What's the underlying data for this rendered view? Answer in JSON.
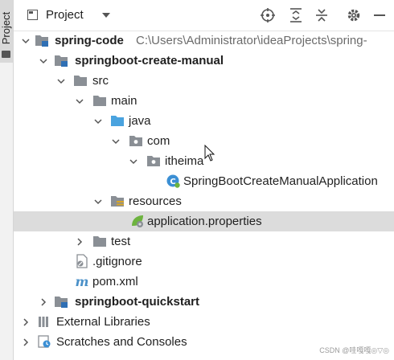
{
  "stripe": {
    "label": "Project"
  },
  "toolbar": {
    "title": "Project",
    "actions": [
      "locate-icon",
      "expand-all-icon",
      "collapse-all-icon",
      "gear-icon",
      "minimize-icon"
    ]
  },
  "colors": {
    "folder": "#8a8f95",
    "source_folder": "#4aa3df",
    "selected_row": "#dcdcdc",
    "spring": "#6db33f"
  },
  "tree": [
    {
      "label": "spring-code",
      "path": "C:\\Users\\Administrator\\ideaProjects\\spring-",
      "bold": true,
      "icon": "module-folder-icon",
      "expanded": true
    },
    {
      "label": "springboot-create-manual",
      "bold": true,
      "icon": "module-folder-icon",
      "expanded": true
    },
    {
      "label": "src",
      "icon": "folder-icon",
      "expanded": true
    },
    {
      "label": "main",
      "icon": "folder-icon",
      "expanded": true
    },
    {
      "label": "java",
      "icon": "source-folder-icon",
      "expanded": true
    },
    {
      "label": "com",
      "icon": "package-icon",
      "expanded": true
    },
    {
      "label": "itheima",
      "icon": "package-icon",
      "expanded": true
    },
    {
      "label": "SpringBootCreateManualApplication",
      "icon": "spring-class-icon"
    },
    {
      "label": "resources",
      "icon": "resources-folder-icon",
      "expanded": true
    },
    {
      "label": "application.properties",
      "icon": "spring-properties-icon",
      "selected": true
    },
    {
      "label": "test",
      "icon": "folder-icon",
      "expanded": false
    },
    {
      "label": ".gitignore",
      "icon": "gitignore-file-icon"
    },
    {
      "label": "pom.xml",
      "icon": "maven-icon"
    },
    {
      "label": "springboot-quickstart",
      "bold": true,
      "icon": "module-folder-icon",
      "expanded": false
    },
    {
      "label": "External Libraries",
      "icon": "libraries-icon",
      "expanded": false
    },
    {
      "label": "Scratches and Consoles",
      "icon": "scratches-icon",
      "expanded": false
    }
  ],
  "watermark": "CSDN @哇嘎嘎◎▽◎"
}
